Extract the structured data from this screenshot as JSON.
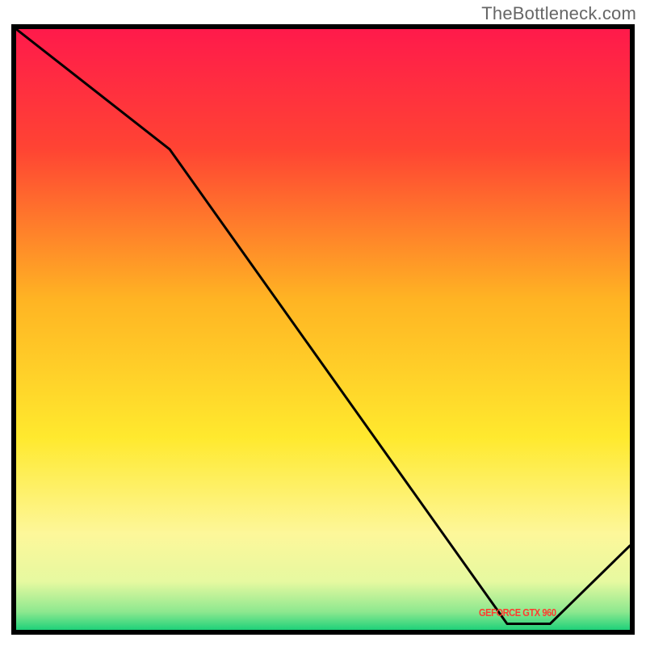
{
  "attribution": "TheBottleneck.com",
  "marker": {
    "text": "GEFORCE GTX 960"
  },
  "chart_data": {
    "type": "line",
    "title": "",
    "xlabel": "",
    "ylabel": "",
    "xlim": [
      0,
      100
    ],
    "ylim": [
      0,
      100
    ],
    "grid": false,
    "series": [
      {
        "name": "curve",
        "x": [
          0,
          25,
          80,
          87,
          100
        ],
        "values": [
          100,
          80,
          1,
          1,
          14
        ]
      }
    ],
    "annotations": [
      {
        "text": "GEFORCE GTX 960",
        "x": 82,
        "y": 2
      }
    ],
    "background_gradient": {
      "type": "vertical",
      "stops": [
        {
          "pos": 0.0,
          "color": "#ff1a4b"
        },
        {
          "pos": 0.2,
          "color": "#ff4433"
        },
        {
          "pos": 0.45,
          "color": "#ffb423"
        },
        {
          "pos": 0.68,
          "color": "#ffe92e"
        },
        {
          "pos": 0.84,
          "color": "#fdf79a"
        },
        {
          "pos": 0.92,
          "color": "#e6f9a0"
        },
        {
          "pos": 0.97,
          "color": "#8de88f"
        },
        {
          "pos": 1.0,
          "color": "#1fd17a"
        }
      ]
    }
  }
}
